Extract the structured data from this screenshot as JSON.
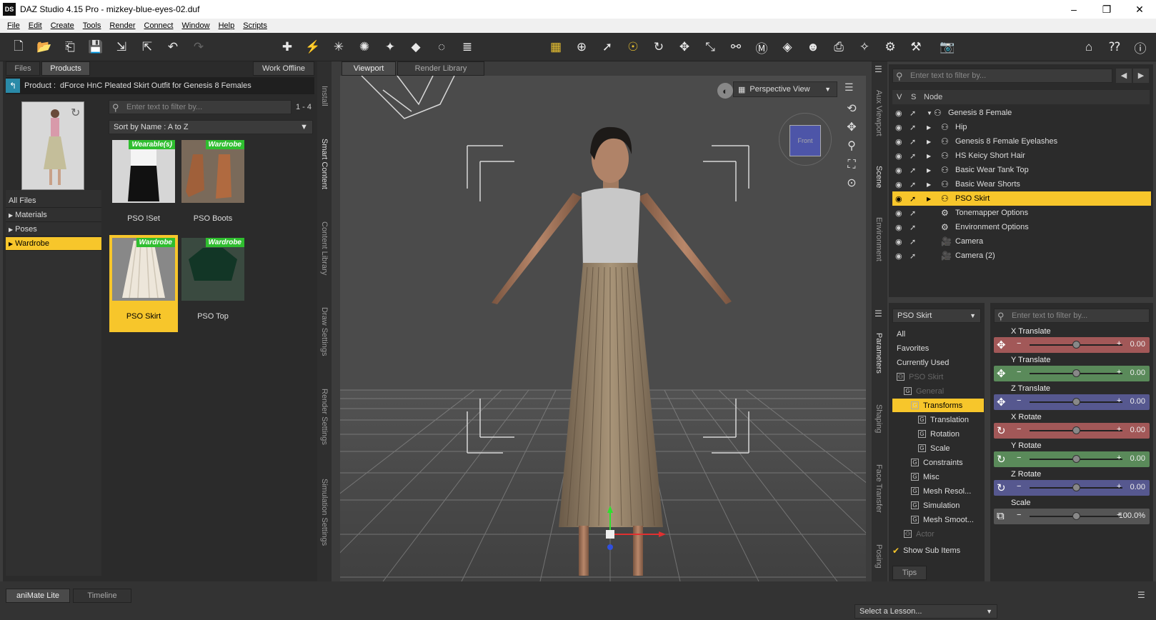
{
  "window": {
    "title": "DAZ Studio 4.15 Pro - mizkey-blue-eyes-02.duf",
    "logo": "DS",
    "minimize": "–",
    "maximize": "❐",
    "close": "✕"
  },
  "menu": [
    "File",
    "Edit",
    "Create",
    "Tools",
    "Render",
    "Connect",
    "Window",
    "Help",
    "Scripts"
  ],
  "content_panel": {
    "tabs": [
      "Files",
      "Products"
    ],
    "work_offline": "Work Offline",
    "product_label": "Product :",
    "product_name": "dForce HnC Pleated Skirt Outfit for Genesis 8 Females",
    "filter_placeholder": "Enter text to filter by...",
    "count": "1 - 4",
    "sort": "Sort by Name : A to Z",
    "categories": [
      {
        "label": "All Files"
      },
      {
        "label": "Materials"
      },
      {
        "label": "Poses"
      },
      {
        "label": "Wardrobe"
      }
    ],
    "items": [
      {
        "label": "PSO !Set",
        "badge": "Wearable(s)"
      },
      {
        "label": "PSO Boots",
        "badge": "Wardrobe"
      },
      {
        "label": "PSO Skirt",
        "badge": "Wardrobe"
      },
      {
        "label": "PSO Top",
        "badge": "Wardrobe"
      }
    ],
    "side_tabs": [
      "Install",
      "Smart Content",
      "Content Library",
      "Draw Settings",
      "Render Settings",
      "Simulation Settings"
    ]
  },
  "viewport": {
    "tabs": [
      "Viewport",
      "Render Library"
    ],
    "view": "Perspective View",
    "cube_face": "Front"
  },
  "scene": {
    "side_tabs": [
      "Aux Viewport",
      "Scene",
      "Environment"
    ],
    "filter_placeholder": "Enter text to filter by...",
    "columns": [
      "V",
      "S",
      "Node"
    ],
    "nodes": [
      {
        "label": "Genesis 8 Female",
        "expander": "▼"
      },
      {
        "label": "Hip",
        "expander": "▶"
      },
      {
        "label": "Genesis 8 Female Eyelashes",
        "expander": "▶"
      },
      {
        "label": "HS Keicy Short Hair",
        "expander": "▶"
      },
      {
        "label": "Basic Wear Tank Top",
        "expander": "▶"
      },
      {
        "label": "Basic Wear Shorts",
        "expander": "▶"
      },
      {
        "label": "PSO Skirt",
        "expander": "▶"
      },
      {
        "label": "Tonemapper Options",
        "expander": ""
      },
      {
        "label": "Environment Options",
        "expander": ""
      },
      {
        "label": "Camera",
        "expander": ""
      },
      {
        "label": "Camera (2)",
        "expander": ""
      }
    ]
  },
  "parameters": {
    "side_tabs": [
      "Parameters",
      "Shaping",
      "Face Transfer",
      "Posing"
    ],
    "node_select": "PSO Skirt",
    "filter_placeholder": "Enter text to filter by...",
    "tree": [
      {
        "label": "All",
        "indent": 0
      },
      {
        "label": "Favorites",
        "indent": 0
      },
      {
        "label": "Currently Used",
        "indent": 0
      },
      {
        "label": "PSO Skirt",
        "indent": 0,
        "dim": true
      },
      {
        "label": "General",
        "indent": 1,
        "dim": true
      },
      {
        "label": "Transforms",
        "indent": 2
      },
      {
        "label": "Translation",
        "indent": 3
      },
      {
        "label": "Rotation",
        "indent": 3
      },
      {
        "label": "Scale",
        "indent": 3
      },
      {
        "label": "Constraints",
        "indent": 2
      },
      {
        "label": "Misc",
        "indent": 2
      },
      {
        "label": "Mesh Resol...",
        "indent": 2
      },
      {
        "label": "Simulation",
        "indent": 2
      },
      {
        "label": "Mesh Smoot...",
        "indent": 2
      },
      {
        "label": "Actor",
        "indent": 1,
        "dim": true
      }
    ],
    "show_sub_items": "Show Sub Items",
    "sliders": [
      {
        "name": "X Translate",
        "value": "0.00",
        "color": "#a25858"
      },
      {
        "name": "Y Translate",
        "value": "0.00",
        "color": "#5a8a5a"
      },
      {
        "name": "Z Translate",
        "value": "0.00",
        "color": "#56588f"
      },
      {
        "name": "X Rotate",
        "value": "0.00",
        "color": "#a25858"
      },
      {
        "name": "Y Rotate",
        "value": "0.00",
        "color": "#5a8a5a"
      },
      {
        "name": "Z Rotate",
        "value": "0.00",
        "color": "#56588f"
      },
      {
        "name": "Scale",
        "value": "100.0%",
        "color": "#555555"
      }
    ],
    "tips": "Tips"
  },
  "bottom": {
    "tabs": [
      "aniMate Lite",
      "Timeline"
    ],
    "lesson": "Select a Lesson..."
  }
}
